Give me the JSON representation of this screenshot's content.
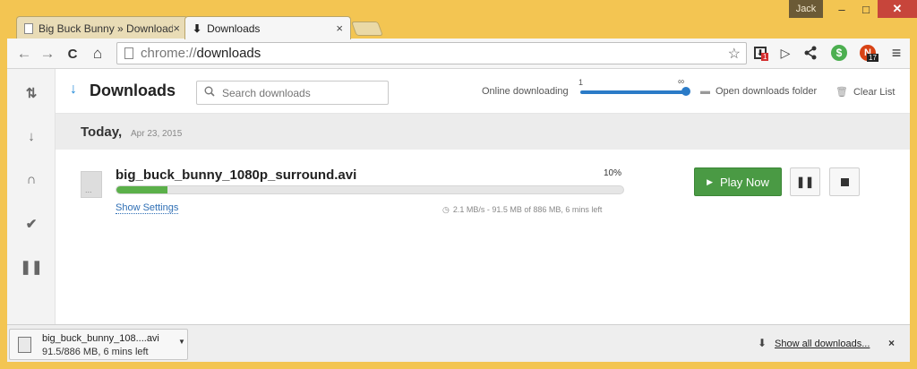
{
  "window": {
    "user": "Jack",
    "minimize": "–",
    "maximize": "□",
    "close": "✕"
  },
  "tabs": [
    {
      "title": "Big Buck Bunny » Download",
      "close": "×"
    },
    {
      "title": "Downloads",
      "close": "×"
    }
  ],
  "toolbar": {
    "back": "←",
    "forward": "→",
    "reload": "C",
    "home": "⌂",
    "url_scheme": "chrome://",
    "url_path": "downloads",
    "bookmark": "☆",
    "extensions": [
      {
        "name": "download-ext-icon",
        "glyph": "⬇",
        "badge": "1",
        "badge_color": "#d32f2f"
      },
      {
        "name": "play-ext-icon",
        "glyph": "▷"
      },
      {
        "name": "share-ext-icon",
        "glyph": "⋲"
      },
      {
        "name": "money-ext-icon",
        "glyph": "$",
        "color": "#4caf50"
      },
      {
        "name": "n-ext-icon",
        "glyph": "N",
        "badge": "17",
        "color": "#d84315"
      }
    ],
    "menu": "≡"
  },
  "page": {
    "title": "Downloads",
    "search_placeholder": "Search downloads",
    "online_label": "Online downloading",
    "slider_min": "1",
    "slider_max": "∞",
    "slider_level": 1.0,
    "open_folder": "Open downloads folder",
    "clear_list": "Clear List",
    "accent_color": "#2b7bc7"
  },
  "date_group": {
    "label": "Today,",
    "date": "Apr 23, 2015"
  },
  "download": {
    "file_name": "big_buck_bunny_1080p_surround.avi",
    "percent_text": "10%",
    "progress": 0.1,
    "show_settings": "Show Settings",
    "speed_text": "2.1 MB/s - 91.5 MB of 886 MB, 6 mins left",
    "play_label": "Play Now",
    "play_color": "#4a9a44"
  },
  "shelf": {
    "file_name": "big_buck_bunny_108....avi",
    "status": "91.5/886 MB, 6 mins left",
    "show_all": "Show all downloads...",
    "close": "×"
  }
}
